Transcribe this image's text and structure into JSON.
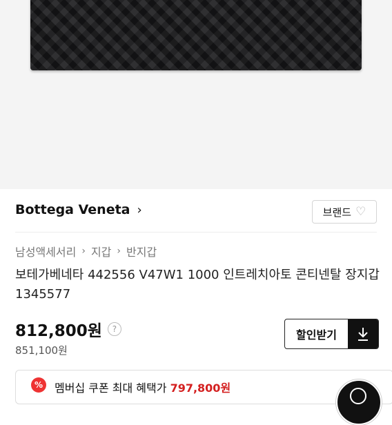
{
  "brand": {
    "name": "Bottega Veneta",
    "button_label": "브랜드"
  },
  "breadcrumb": [
    "남성액세서리",
    "지갑",
    "반지갑"
  ],
  "product": {
    "title": "보테가베네타 442556 V47W1 1000 인트레치아토 콘티넨탈 장지갑 1345577",
    "price": "812,800원",
    "original_price": "851,100원"
  },
  "coupon_download": {
    "label": "할인받기"
  },
  "membership": {
    "badge": "%",
    "text": "멤버십 쿠폰 최대 혜택가",
    "price": "797,800원"
  },
  "icons": {
    "brand_chevron": "chevron-right-icon",
    "heart": "heart-icon",
    "help": "question-icon",
    "download": "download-icon"
  }
}
